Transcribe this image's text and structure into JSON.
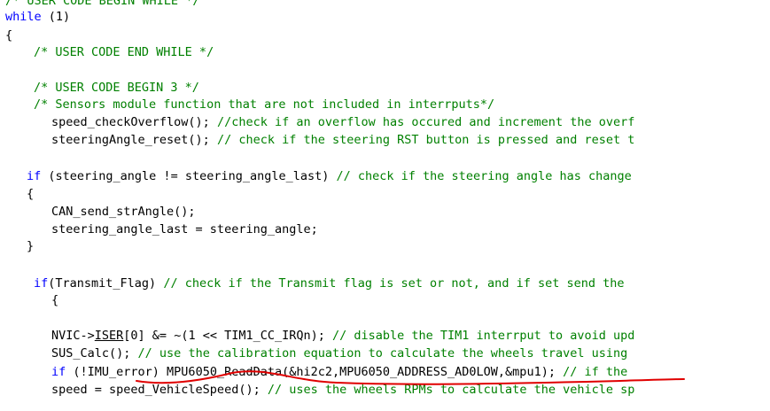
{
  "editor": {
    "colors": {
      "background": "#ffffff",
      "keyword": "#0000ff",
      "comment": "#008000",
      "text": "#000000",
      "annotation": "#e00000"
    },
    "lines": [
      {
        "id": "l0",
        "tokens": [
          {
            "t": "/* USER CODE BEGIN WHILE */",
            "c": "comment"
          }
        ]
      },
      {
        "id": "l1",
        "tokens": [
          {
            "t": "while",
            "c": "kw"
          },
          {
            "t": " (1)",
            "c": "plain"
          }
        ]
      },
      {
        "id": "l2",
        "tokens": [
          {
            "t": "{",
            "c": "plain"
          }
        ]
      },
      {
        "id": "l3",
        "tokens": [
          {
            "t": "/* USER CODE END WHILE */",
            "c": "comment"
          }
        ]
      },
      {
        "id": "l4",
        "tokens": [
          {
            "t": "/* USER CODE BEGIN 3 */",
            "c": "comment"
          }
        ]
      },
      {
        "id": "l5",
        "tokens": [
          {
            "t": "/* Sensors module function that are not included in interrputs*/",
            "c": "comment"
          }
        ]
      },
      {
        "id": "l6",
        "tokens": [
          {
            "t": "speed_checkOverflow(); ",
            "c": "plain"
          },
          {
            "t": "//check if an overflow has occured and increment the overf",
            "c": "comment"
          }
        ]
      },
      {
        "id": "l7",
        "tokens": [
          {
            "t": "steeringAngle_reset(); ",
            "c": "plain"
          },
          {
            "t": "// check if the steering RST button is pressed and reset t",
            "c": "comment"
          }
        ]
      },
      {
        "id": "l8",
        "tokens": [
          {
            "t": "if",
            "c": "kw"
          },
          {
            "t": " (steering_angle != steering_angle_last) ",
            "c": "plain"
          },
          {
            "t": "// check if the steering angle has change",
            "c": "comment"
          }
        ]
      },
      {
        "id": "l9",
        "tokens": [
          {
            "t": "{",
            "c": "plain"
          }
        ]
      },
      {
        "id": "l10",
        "tokens": [
          {
            "t": "CAN_send_strAngle();",
            "c": "plain"
          }
        ]
      },
      {
        "id": "l11",
        "tokens": [
          {
            "t": "steering_angle_last = steering_angle;",
            "c": "plain"
          }
        ]
      },
      {
        "id": "l12",
        "tokens": [
          {
            "t": "}",
            "c": "plain"
          }
        ]
      },
      {
        "id": "l13",
        "tokens": [
          {
            "t": "if",
            "c": "kw"
          },
          {
            "t": "(Transmit_Flag) ",
            "c": "plain"
          },
          {
            "t": "// check if the Transmit flag is set or not, and if set send the",
            "c": "comment"
          }
        ]
      },
      {
        "id": "l14",
        "tokens": [
          {
            "t": "{",
            "c": "plain"
          }
        ]
      },
      {
        "id": "l15",
        "tokens": [
          {
            "t": "NVIC->",
            "c": "plain"
          },
          {
            "t": "ISER",
            "c": "plain",
            "u": true
          },
          {
            "t": "[0] &= ~(1 << TIM1_CC_IRQn); ",
            "c": "plain"
          },
          {
            "t": "// disable the TIM1 interrput to avoid upd",
            "c": "comment"
          }
        ]
      },
      {
        "id": "l16",
        "tokens": [
          {
            "t": "SUS_Calc(); ",
            "c": "plain"
          },
          {
            "t": "// use the calibration equation to calculate the wheels travel using",
            "c": "comment"
          }
        ]
      },
      {
        "id": "l17",
        "tokens": [
          {
            "t": "if",
            "c": "kw"
          },
          {
            "t": " (!IMU_error) MPU6050_ReadData(&hi2c2,MPU6050_ADDRESS_AD0LOW,&mpu1); ",
            "c": "plain"
          },
          {
            "t": "// if the",
            "c": "comment"
          }
        ]
      },
      {
        "id": "l18",
        "tokens": [
          {
            "t": "speed = speed_VehicleSpeed(); ",
            "c": "plain"
          },
          {
            "t": "// uses the wheels RPMs to calculate the vehicle sp",
            "c": "comment"
          }
        ]
      }
    ]
  }
}
